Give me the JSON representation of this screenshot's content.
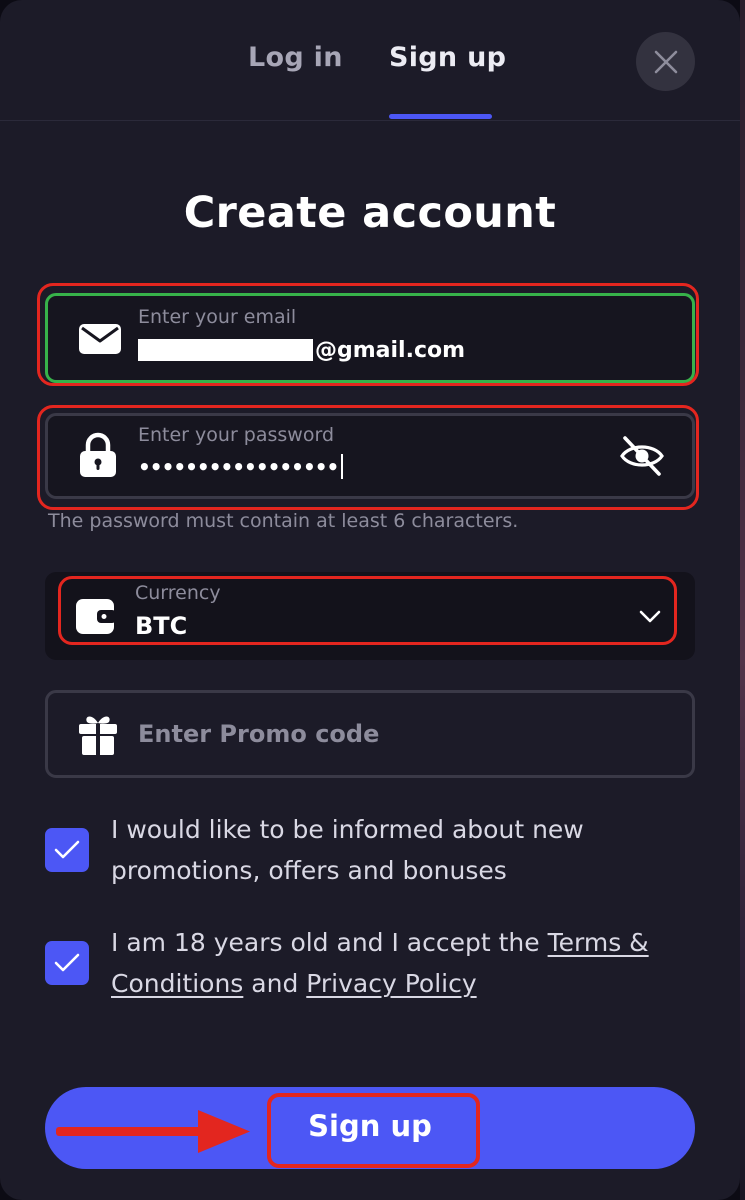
{
  "tabs": {
    "login_label": "Log in",
    "signup_label": "Sign up",
    "active": "signup"
  },
  "form": {
    "title": "Create account",
    "email": {
      "label": "Enter your email",
      "visible_value": "@gmail.com",
      "icon": "envelope-icon"
    },
    "password": {
      "label": "Enter your password",
      "masked_value": "•••••••••••••••••",
      "hint": "The password must contain at least 6 characters.",
      "icon": "lock-icon",
      "toggle_icon": "eye-slash-icon"
    },
    "currency": {
      "label": "Currency",
      "value": "BTC",
      "icon": "wallet-icon"
    },
    "promo": {
      "placeholder": "Enter Promo code",
      "icon": "gift-icon"
    },
    "consent_promos": {
      "checked": true,
      "text": "I would like to be informed about new promotions, offers and bonuses"
    },
    "consent_age": {
      "checked": true,
      "text_before": "I am 18 years old and I accept the ",
      "terms_link": "Terms & Conditions",
      "text_middle": " and ",
      "privacy_link": "Privacy Policy"
    },
    "submit_label": "Sign up"
  },
  "colors": {
    "accent": "#4c57f5",
    "panel": "#1c1b28",
    "valid": "#37b24a",
    "annotation": "#e3261f"
  }
}
